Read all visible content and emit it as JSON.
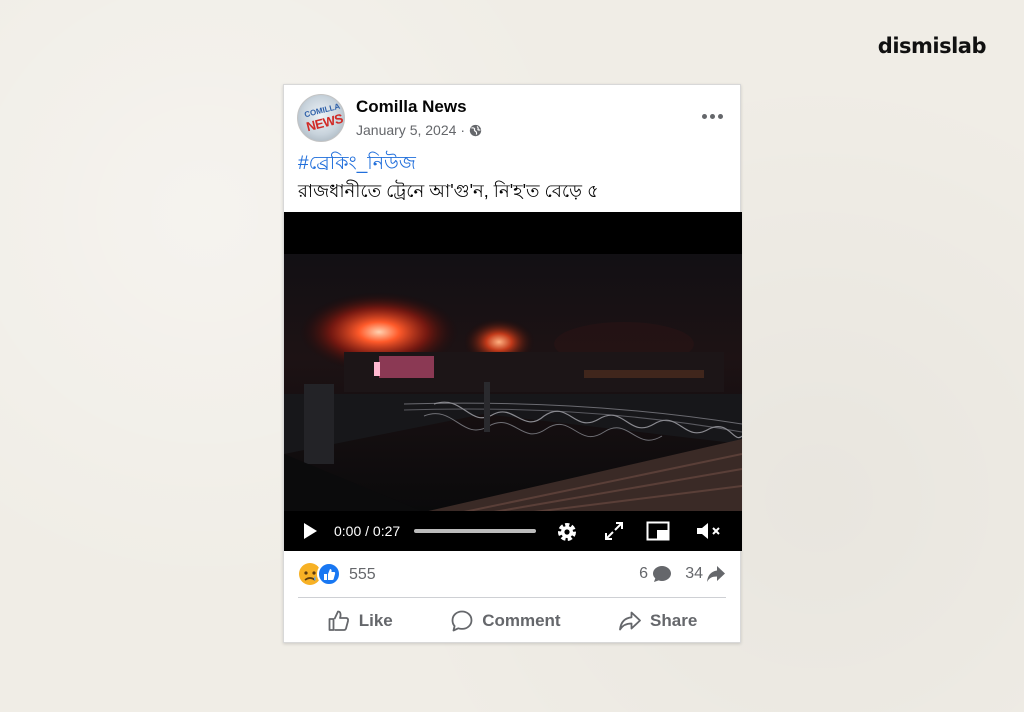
{
  "brand": "dismislab",
  "post": {
    "page_name": "Comilla News",
    "date": "January 5, 2024",
    "separator": "·",
    "hashtag": "#ব্রেকিং_নিউজ",
    "caption": "রাজধানীতে ট্রেনে আ'গু'ন, নি'হ'ত বেড়ে ৫",
    "avatar": {
      "top_text": "COMILLA",
      "bottom_text": "NEWS"
    }
  },
  "video": {
    "time": "0:00 / 0:27",
    "progress": 0.0,
    "muted": true
  },
  "stats": {
    "reaction_count": "555",
    "reactions": [
      "sad-icon",
      "like-icon"
    ],
    "comment_count": "6",
    "share_count": "34"
  },
  "actions": {
    "like": "Like",
    "comment": "Comment",
    "share": "Share"
  },
  "colors": {
    "background": "#f0ede6",
    "hashtag": "#216fdb",
    "secondary_text": "#65676b",
    "like_blue": "#1877f2",
    "sad_yellow": "#f7b125"
  }
}
